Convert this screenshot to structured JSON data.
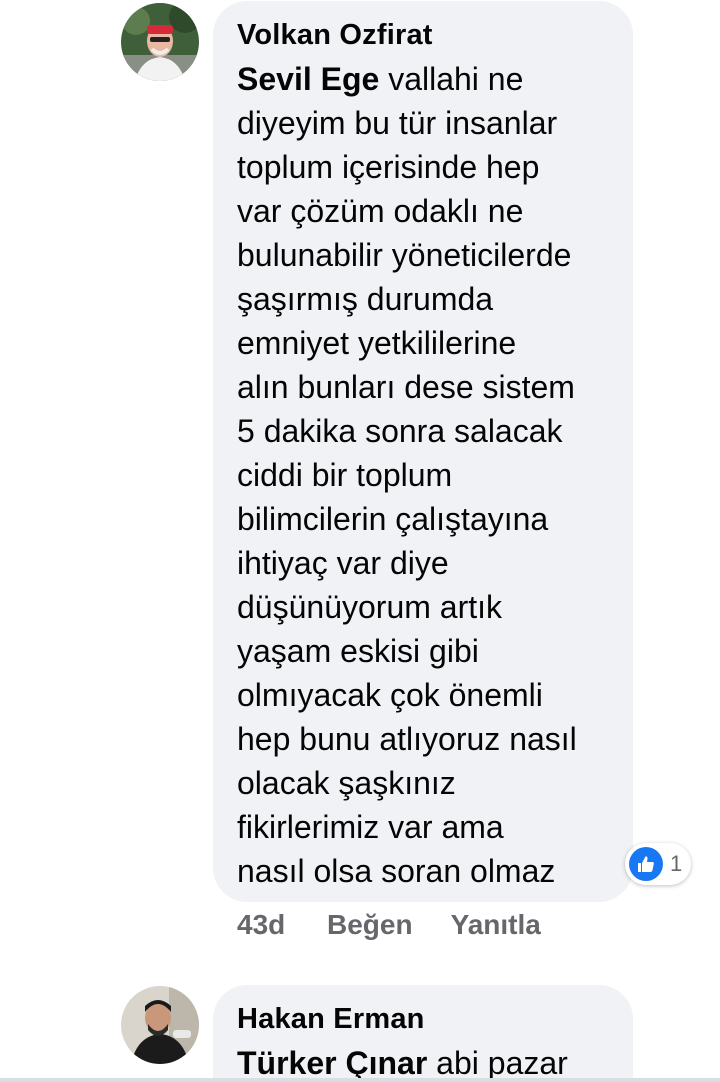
{
  "comment_1": {
    "author": "Volkan Ozfirat",
    "mention": "Sevil Ege",
    "lines": [
      " vallahi ne",
      "diyeyim bu tür insanlar",
      "toplum içerisinde hep",
      "var çözüm odaklı ne",
      "bulunabilir yöneticilerde",
      "şaşırmış durumda",
      "emniyet yetkililerine",
      "alın bunları dese sistem",
      "5 dakika sonra salacak",
      "ciddi bir toplum",
      "bilimcilerin çalıştayına",
      "ihtiyaç var diye",
      "düşünüyorum artık",
      "yaşam eskisi gibi",
      "olmıyacak çok önemli",
      "hep bunu atlıyoruz nasıl",
      "olacak şaşkınız",
      "fikirlerimiz var ama",
      "nasıl olsa soran olmaz"
    ],
    "reaction": {
      "icon": "thumbs-up-icon",
      "count": "1",
      "color": "#1877f2"
    },
    "time": "43d",
    "like_label": "Beğen",
    "reply_label": "Yanıtla"
  },
  "comment_2": {
    "author": "Hakan Erman",
    "mention": "Türker Çınar",
    "text": " abi pazar"
  },
  "colors": {
    "bubble": "#f0f2f5",
    "text": "#050505",
    "meta": "#65676b"
  }
}
